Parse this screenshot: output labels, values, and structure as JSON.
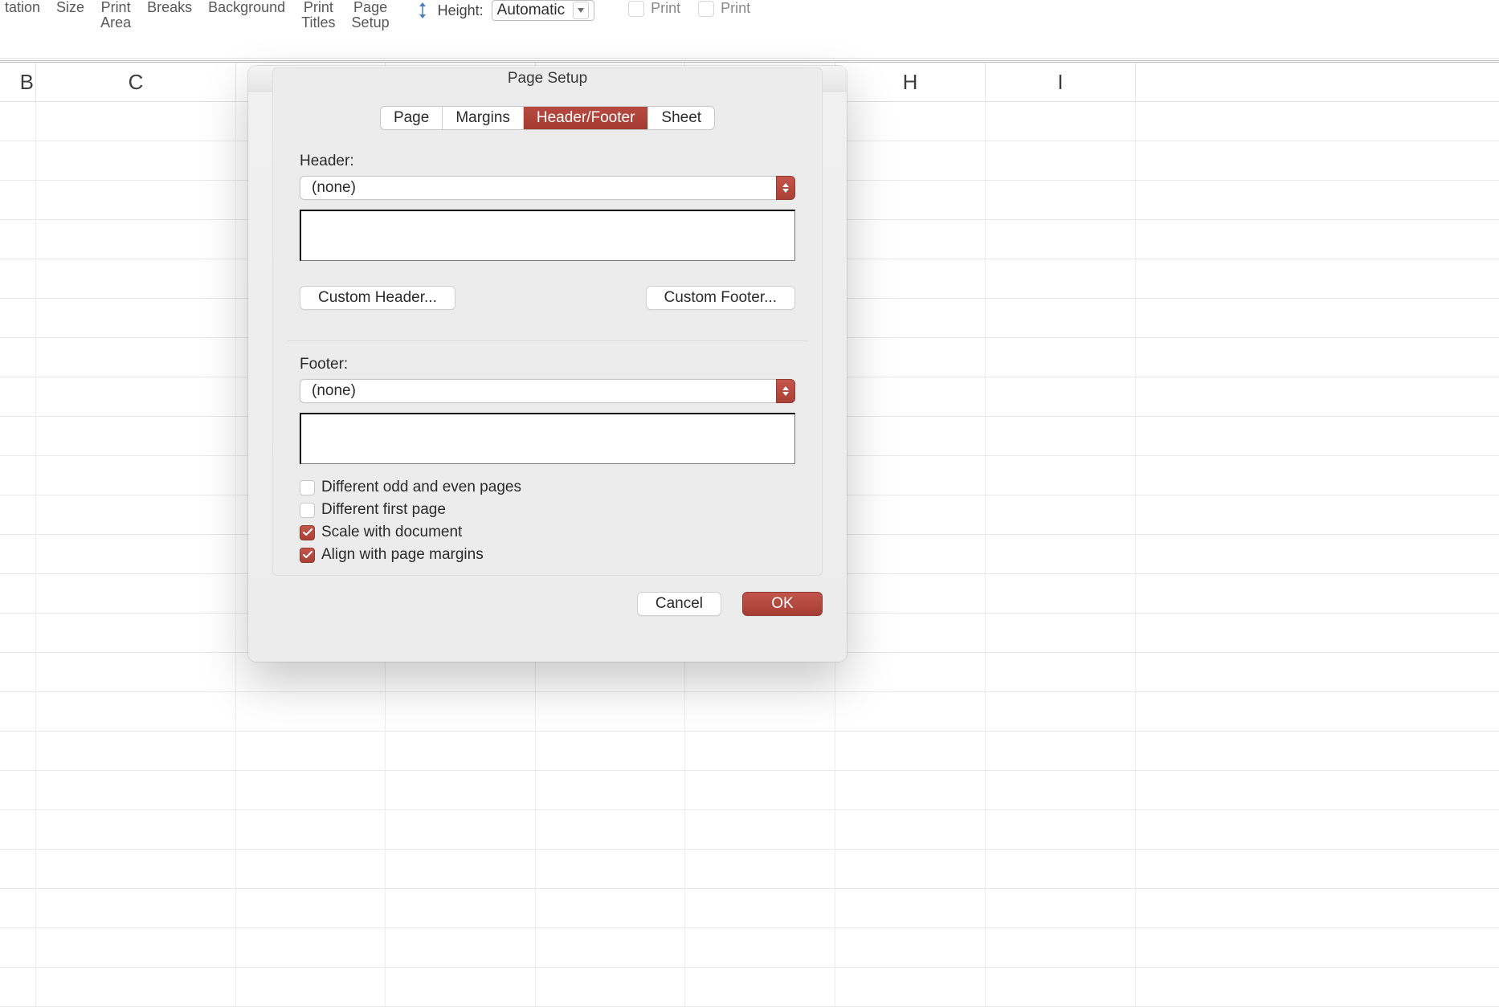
{
  "ribbon": {
    "items": [
      {
        "line1": "tation"
      },
      {
        "line1": "Size"
      },
      {
        "line1": "Print",
        "line2": "Area"
      },
      {
        "line1": "Breaks"
      },
      {
        "line1": "Background"
      },
      {
        "line1": "Print",
        "line2": "Titles"
      },
      {
        "line1": "Page",
        "line2": "Setup"
      }
    ],
    "height_label": "Height:",
    "height_value": "Automatic",
    "print_label1": "Print",
    "print_label2": "Print"
  },
  "columns": [
    "B",
    "C",
    "",
    "",
    "",
    "",
    "H",
    "I"
  ],
  "dialog": {
    "title": "Page Setup",
    "tabs": {
      "page": "Page",
      "margins": "Margins",
      "header_footer": "Header/Footer",
      "sheet": "Sheet"
    },
    "header_label": "Header:",
    "header_value": "(none)",
    "custom_header": "Custom Header...",
    "custom_footer": "Custom Footer...",
    "footer_label": "Footer:",
    "footer_value": "(none)",
    "checks": {
      "odd_even": "Different odd and even pages",
      "first_page": "Different first page",
      "scale_doc": "Scale with document",
      "align_margins": "Align with page margins"
    },
    "cancel": "Cancel",
    "ok": "OK"
  }
}
